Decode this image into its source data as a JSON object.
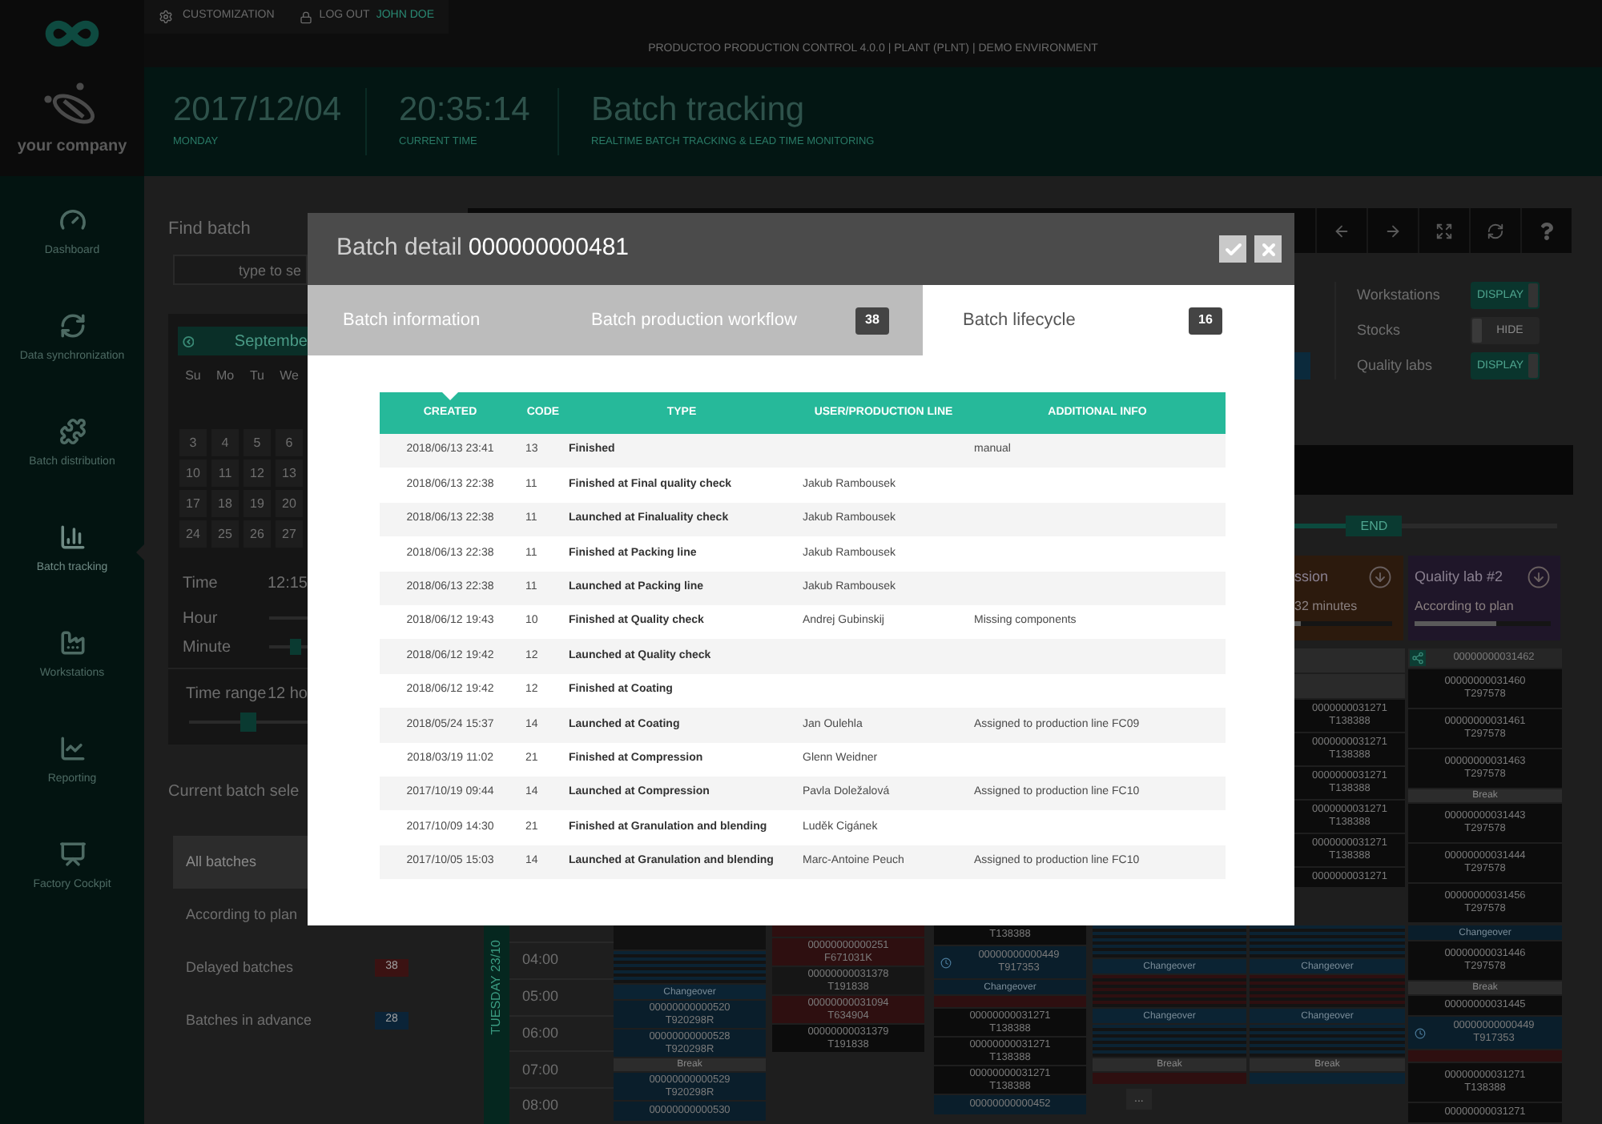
{
  "top_bar": {
    "customization": "CUSTOMIZATION",
    "logout": "LOG OUT",
    "user": "JOHN DOE",
    "environment": "PRODUCTOO PRODUCTION CONTROL 4.0.0 | PLANT (PLNT) | DEMO ENVIRONMENT"
  },
  "company_logo": {
    "name": "your company"
  },
  "header": {
    "date": "2017/12/04",
    "weekday": "MONDAY",
    "time": "20:35:14",
    "time_label": "CURRENT TIME",
    "title": "Batch tracking",
    "subtitle": "REALTIME BATCH TRACKING & LEAD TIME MONITORING"
  },
  "sidebar": {
    "items": [
      {
        "label": "Dashboard",
        "selected": false
      },
      {
        "label": "Data synchronization",
        "selected": false
      },
      {
        "label": "Batch distribution",
        "selected": false
      },
      {
        "label": "Batch tracking",
        "selected": true
      },
      {
        "label": "Workstations",
        "selected": false
      },
      {
        "label": "Reporting",
        "selected": false
      },
      {
        "label": "Factory Cockpit",
        "selected": false
      }
    ]
  },
  "find_batch": {
    "title": "Find batch",
    "placeholder": "type to se"
  },
  "calendar": {
    "month": "Septembe",
    "weekdays": [
      "Su",
      "Mo",
      "Tu",
      "We"
    ],
    "weeks": [
      [
        "3",
        "4",
        "5",
        "6"
      ],
      [
        "10",
        "11",
        "12",
        "13"
      ],
      [
        "17",
        "18",
        "19",
        "20"
      ],
      [
        "24",
        "25",
        "26",
        "27"
      ]
    ],
    "time_label": "Time",
    "time_value": "12:15",
    "sliders": [
      {
        "label": "Hour"
      },
      {
        "label": "Minute",
        "level": 0.75
      }
    ],
    "time_range": {
      "label": "Time range",
      "value": "12 ho",
      "level": 0.5
    }
  },
  "batch_selection": {
    "title": "Current batch sele",
    "items": [
      {
        "label": "All batches",
        "selected": true
      },
      {
        "label": "According to plan",
        "selected": false
      },
      {
        "label": "Delayed batches",
        "selected": false,
        "count": "38",
        "color": "#3b1212"
      },
      {
        "label": "Batches in advance",
        "selected": false,
        "count": "28",
        "color": "#0b2438"
      }
    ]
  },
  "layers": [
    {
      "label": "Workstations",
      "on": true,
      "state": "DISPLAY"
    },
    {
      "label": "Stocks",
      "on": false,
      "state": "HIDE"
    },
    {
      "label": "Quality labs",
      "on": true,
      "state": "DISPLAY"
    }
  ],
  "range_slider": {
    "thumb": "END",
    "level": 0.25
  },
  "workstations": [
    {
      "name": "ssion",
      "status": "32 minutes",
      "color": "#2c1a0d",
      "level": 0.06
    },
    {
      "name": "Quality lab #2",
      "status": "According to plan",
      "color": "#1f1629",
      "level": 0.6
    }
  ],
  "timeline": {
    "day": "TUESDAY 23/10",
    "hours": [
      "04:00",
      "05:00",
      "06:00",
      "07:00",
      "08:00"
    ],
    "upper_lanes": [
      {
        "blocks": [
          {
            "kind": "blank",
            "color": "#2a2a2a"
          },
          {
            "kind": "blank",
            "color": "#2a2a2a"
          },
          {
            "kind": "card",
            "id": "0000000031271",
            "code": "T138388",
            "color": "#0c0c0c"
          },
          {
            "kind": "card",
            "id": "0000000031271",
            "code": "T138388",
            "color": "#0c0c0c"
          },
          {
            "kind": "card",
            "id": "0000000031271",
            "code": "T138388",
            "color": "#0c0c0c"
          },
          {
            "kind": "card",
            "id": "0000000031271",
            "code": "T138388",
            "color": "#0c0c0c"
          },
          {
            "kind": "card",
            "id": "0000000031271",
            "code": "T138388",
            "color": "#0c0c0c"
          },
          {
            "kind": "card",
            "id": "0000000031271",
            "color": "#0c0c0c"
          }
        ]
      },
      {
        "blocks": [
          {
            "kind": "linked",
            "id": "00000000031462",
            "color": "#262626"
          },
          {
            "kind": "card",
            "id": "00000000031460",
            "code": "T297578",
            "color": "#0c0c0c"
          },
          {
            "kind": "card",
            "id": "00000000031461",
            "code": "T297578",
            "color": "#0c0c0c"
          },
          {
            "kind": "card",
            "id": "00000000031463",
            "code": "T297578",
            "color": "#0c0c0c"
          },
          {
            "kind": "break",
            "label": "Break"
          },
          {
            "kind": "card",
            "id": "00000000031443",
            "code": "T297578",
            "color": "#0c0c0c"
          },
          {
            "kind": "card",
            "id": "00000000031444",
            "code": "T297578",
            "color": "#0c0c0c"
          },
          {
            "kind": "card",
            "id": "00000000031456",
            "code": "T297578",
            "color": "#0c0c0c"
          }
        ]
      }
    ],
    "lower_lanes": [
      {
        "blocks": [
          {
            "kind": "blank",
            "color": "#111111"
          },
          {
            "kind": "stripes",
            "color": "#0b2333"
          },
          {
            "kind": "changeover",
            "label": "Changeover",
            "color": "#0b2333"
          },
          {
            "kind": "card",
            "id": "00000000000520",
            "code": "T920298R",
            "color": "#0a1e2b"
          },
          {
            "kind": "card",
            "id": "00000000000528",
            "code": "T920298R",
            "color": "#0a1e2b"
          },
          {
            "kind": "break",
            "label": "Break"
          },
          {
            "kind": "card",
            "id": "00000000000529",
            "code": "T920298R",
            "color": "#0a1e2b"
          },
          {
            "kind": "card",
            "id": "00000000000530",
            "color": "#0a1e2b"
          }
        ]
      },
      {
        "blocks": [
          {
            "kind": "strip",
            "color": "#2e0f10"
          },
          {
            "kind": "card",
            "id": "00000000000251",
            "code": "F671031K",
            "color": "#2e0f10"
          },
          {
            "kind": "card",
            "id": "00000000031378",
            "code": "T191838",
            "color": "#161616"
          },
          {
            "kind": "card",
            "id": "00000000031094",
            "code": "T634904",
            "color": "#2e0f10"
          },
          {
            "kind": "card",
            "id": "00000000031379",
            "code": "T191838",
            "color": "#0c0c0c"
          }
        ]
      },
      {
        "blocks": [
          {
            "kind": "card",
            "code": "T138388",
            "color": "#0c0c0c"
          },
          {
            "kind": "timed",
            "id": "00000000000449",
            "code": "T917353",
            "color": "#0a1e2b"
          },
          {
            "kind": "changeover",
            "label": "Changeover",
            "color": "#0a1e2b"
          },
          {
            "kind": "strip",
            "color": "#2e0f10"
          },
          {
            "kind": "card",
            "id": "00000000031271",
            "code": "T138388",
            "color": "#0c0c0c"
          },
          {
            "kind": "card",
            "id": "00000000031271",
            "code": "T138388",
            "color": "#0c0c0c"
          },
          {
            "kind": "card",
            "id": "00000000031271",
            "code": "T138388",
            "color": "#0c0c0c"
          },
          {
            "kind": "card",
            "id": "00000000000452",
            "color": "#0a1e2b"
          }
        ]
      },
      {
        "blocks": [
          {
            "kind": "stripes",
            "color": "#0b2333"
          },
          {
            "kind": "changeover",
            "label": "Changeover",
            "color": "#0b2333"
          },
          {
            "kind": "stripes",
            "color": "#2e0f10"
          },
          {
            "kind": "changeover",
            "label": "Changeover",
            "color": "#0b2333"
          },
          {
            "kind": "stripes",
            "color": "#0b2333"
          },
          {
            "kind": "break",
            "label": "Break"
          },
          {
            "kind": "strip",
            "color": "#2e0f10"
          },
          {
            "kind": "more",
            "label": "..."
          }
        ]
      },
      {
        "blocks": [
          {
            "kind": "stripes",
            "color": "#0b2333"
          },
          {
            "kind": "changeover",
            "label": "Changeover",
            "color": "#0b2333"
          },
          {
            "kind": "stripes",
            "color": "#2e0f10"
          },
          {
            "kind": "changeover",
            "label": "Changeover",
            "color": "#0b2333"
          },
          {
            "kind": "stripes",
            "color": "#0b2333"
          },
          {
            "kind": "break",
            "label": "Break"
          },
          {
            "kind": "strip",
            "color": "#0b2333"
          }
        ]
      },
      {
        "blocks": [
          {
            "kind": "changeover",
            "label": "Changeover",
            "color": "#0a1e2b"
          },
          {
            "kind": "card",
            "id": "00000000031446",
            "code": "T297578",
            "color": "#0c0c0c"
          },
          {
            "kind": "break",
            "label": "Break"
          },
          {
            "kind": "card",
            "id": "00000000031445",
            "color": "#0c0c0c"
          },
          {
            "kind": "timed",
            "id": "00000000000449",
            "code": "T917353",
            "color": "#0a1e2b"
          },
          {
            "kind": "strip",
            "color": "#2e0f10"
          },
          {
            "kind": "card",
            "id": "00000000031271",
            "code": "T138388",
            "color": "#0c0c0c"
          },
          {
            "kind": "card",
            "id": "00000000031271",
            "color": "#0c0c0c"
          }
        ]
      }
    ]
  },
  "modal": {
    "title": "Batch detail",
    "batch": "000000000481",
    "tabs": [
      {
        "label": "Batch information",
        "selected": false
      },
      {
        "label": "Batch production workflow",
        "count": "38",
        "selected": false
      },
      {
        "label": "Batch lifecycle",
        "count": "16",
        "selected": true
      }
    ],
    "columns": [
      {
        "label": "CREATED",
        "sorted": true
      },
      {
        "label": "CODE",
        "sorted": false
      },
      {
        "label": "TYPE",
        "sorted": false
      },
      {
        "label": "USER/PRODUCTION LINE",
        "sorted": false
      },
      {
        "label": "ADDITIONAL INFO",
        "sorted": false
      }
    ],
    "rows": [
      {
        "created": "2018/06/13 23:41",
        "code": "13",
        "type": "Finished",
        "info": "manual"
      },
      {
        "created": "2018/06/13 22:38",
        "code": "11",
        "type": "Finished at Final quality check",
        "user": "Jakub Rambousek"
      },
      {
        "created": "2018/06/13 22:38",
        "code": "11",
        "type": "Launched at Finaluality check",
        "user": "Jakub Rambousek"
      },
      {
        "created": "2018/06/13 22:38",
        "code": "11",
        "type": "Finished at Packing line",
        "user": "Jakub Rambousek"
      },
      {
        "created": "2018/06/13 22:38",
        "code": "11",
        "type": "Launched at Packing line",
        "user": "Jakub Rambousek"
      },
      {
        "created": "2018/06/12 19:43",
        "code": "10",
        "type": "Finished at Quality check",
        "user": "Andrej Gubinskij",
        "info": "Missing components"
      },
      {
        "created": "2018/06/12 19:42",
        "code": "12",
        "type": "Launched at Quality check"
      },
      {
        "created": "2018/06/12 19:42",
        "code": "12",
        "type": "Finished at Coating"
      },
      {
        "created": "2018/05/24 15:37",
        "code": "14",
        "type": "Launched at Coating",
        "user": "Jan Oulehla",
        "info": "Assigned to production line FC09"
      },
      {
        "created": "2018/03/19 11:02",
        "code": "21",
        "type": "Finished at Compression",
        "user": "Glenn Weidner"
      },
      {
        "created": "2017/10/19 09:44",
        "code": "14",
        "type": "Launched at Compression",
        "user": "Pavla Doležalová",
        "info": "Assigned to production line FC10"
      },
      {
        "created": "2017/10/09 14:30",
        "code": "21",
        "type": "Finished at Granulation and blending",
        "user": "Luděk Cigánek"
      },
      {
        "created": "2017/10/05 15:03",
        "code": "14",
        "type": "Launched at Granulation and blending",
        "user": "Marc-Antoine Peuch",
        "info": "Assigned to production line FC10"
      }
    ]
  }
}
